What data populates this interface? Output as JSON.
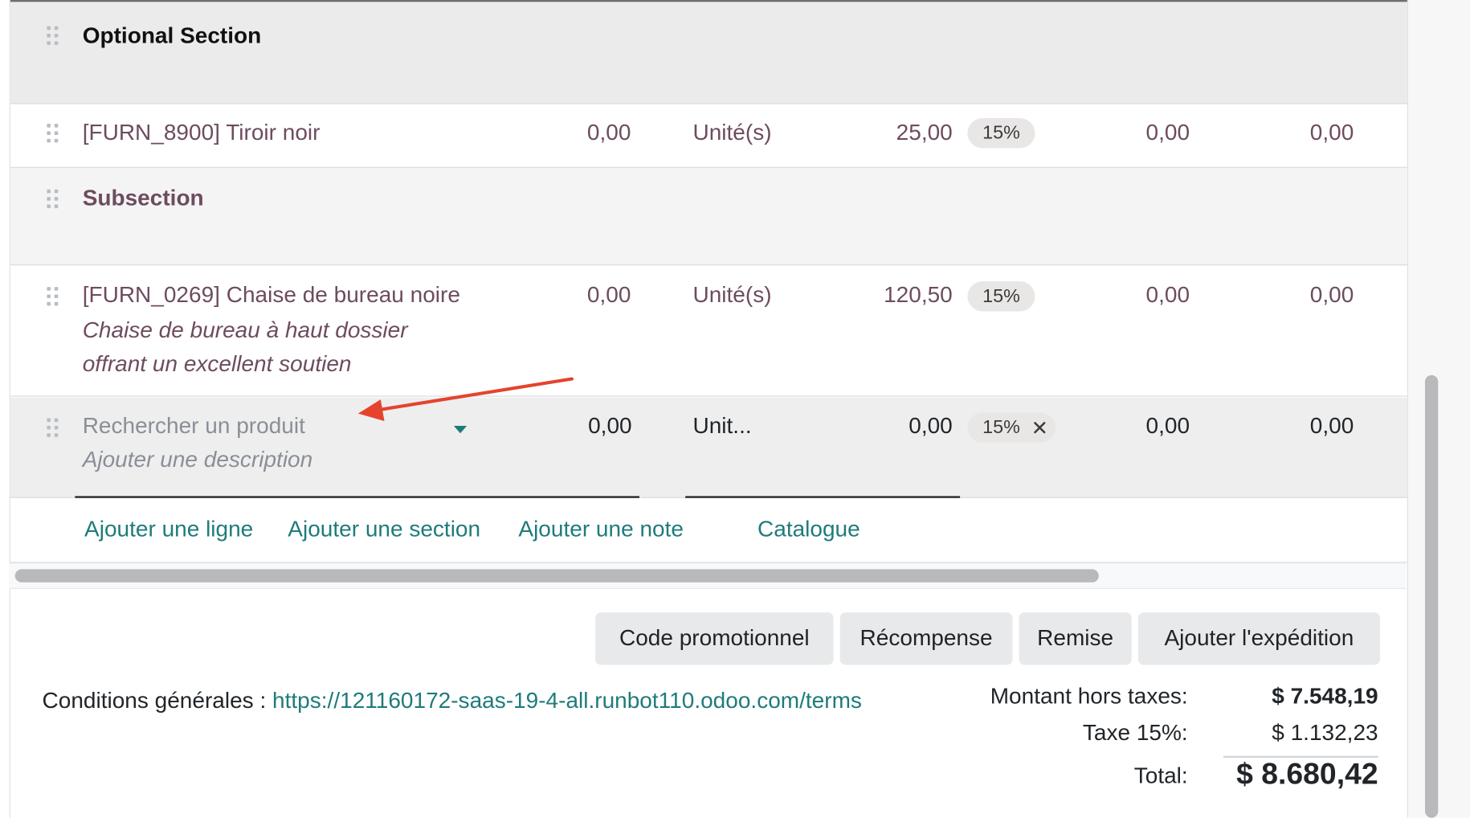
{
  "lines": {
    "section": {
      "label": "Optional Section"
    },
    "product1": {
      "name": "[FURN_8900] Tiroir noir",
      "qty": "0,00",
      "uom": "Unité(s)",
      "price": "25,00",
      "tax": "15%",
      "disc": "0,00",
      "subtotal": "0,00"
    },
    "subsection": {
      "label": "Subsection"
    },
    "product2": {
      "name": "[FURN_0269] Chaise de bureau noire",
      "desc1": "Chaise de bureau à haut dossier",
      "desc2": "offrant un excellent soutien",
      "qty": "0,00",
      "uom": "Unité(s)",
      "price": "120,50",
      "tax": "15%",
      "disc": "0,00",
      "subtotal": "0,00"
    },
    "new_line": {
      "product_placeholder": "Rechercher un produit",
      "desc_placeholder": "Ajouter une description",
      "qty": "0,00",
      "uom": "Unit...",
      "price": "0,00",
      "tax": "15%",
      "disc": "0,00",
      "subtotal": "0,00"
    }
  },
  "actions": {
    "add_line": "Ajouter une ligne",
    "add_section": "Ajouter une section",
    "add_note": "Ajouter une note",
    "catalog": "Catalogue"
  },
  "buttons": {
    "promo": "Code promotionnel",
    "reward": "Récompense",
    "discount": "Remise",
    "shipping": "Ajouter l'expédition"
  },
  "terms": {
    "label": "Conditions générales :",
    "url": "https://121160172-saas-19-4-all.runbot110.odoo.com/terms"
  },
  "totals": {
    "untaxed_label": "Montant hors taxes:",
    "untaxed_value": "$ 7.548,19",
    "tax_label": "Taxe 15%:",
    "tax_value": "$ 1.132,23",
    "total_label": "Total:",
    "total_value": "$ 8.680,42"
  },
  "colors": {
    "link": "#1f7b7b",
    "section_bg": "#ebebeb",
    "annotation_arrow": "#e5432d"
  },
  "icons": {
    "drag_handle": "drag-handle-icon",
    "dropdown": "caret-down-icon",
    "remove_tax": "close-icon"
  }
}
